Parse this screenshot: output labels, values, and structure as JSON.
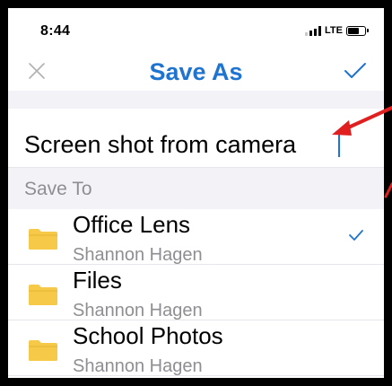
{
  "status_bar": {
    "time": "8:44",
    "network": "LTE",
    "battery_level": 0.58
  },
  "header": {
    "title": "Save As",
    "close_icon": "close-icon",
    "confirm_icon": "checkmark-icon"
  },
  "filename": {
    "value": "Screen shot from camera"
  },
  "save_to": {
    "label": "Save To",
    "folders": [
      {
        "name": "Office Lens",
        "owner": "Shannon Hagen",
        "selected": true
      },
      {
        "name": "Files",
        "owner": "Shannon Hagen",
        "selected": false
      },
      {
        "name": "School Photos",
        "owner": "Shannon Hagen",
        "selected": false
      }
    ]
  },
  "colors": {
    "accent": "#1f74d0",
    "folder": "#f7c948",
    "annotation": "#e02020",
    "secondary_text": "#8e8e93",
    "section_bg": "#f2f2f7"
  }
}
